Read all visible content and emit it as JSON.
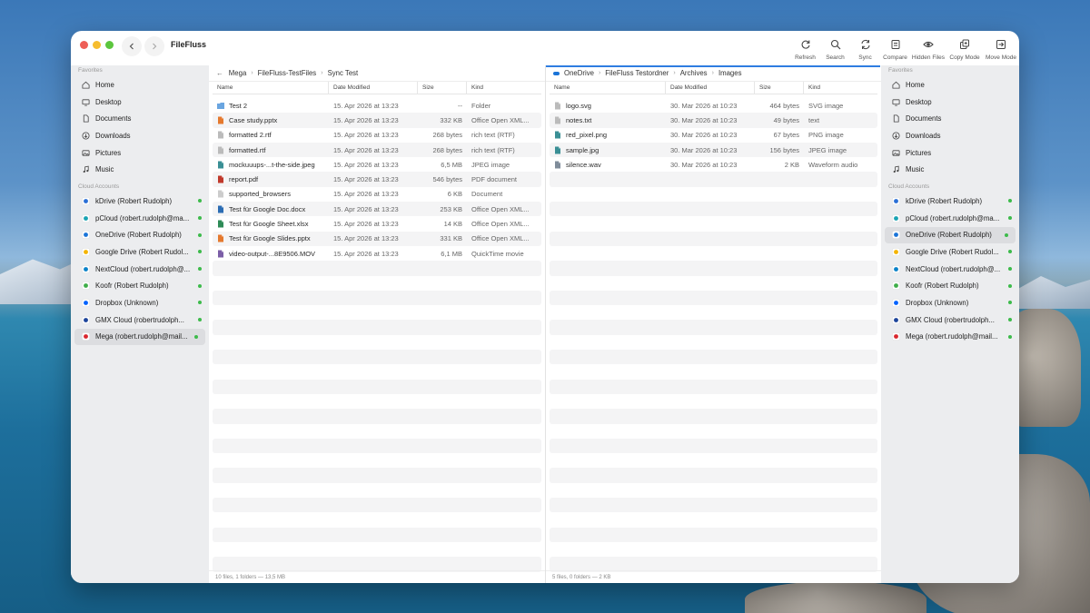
{
  "app": {
    "title": "FileFluss"
  },
  "toolbar": [
    {
      "label": "Refresh",
      "icon": "refresh-icon"
    },
    {
      "label": "Search",
      "icon": "search-icon"
    },
    {
      "label": "Sync",
      "icon": "sync-icon"
    },
    {
      "label": "Compare",
      "icon": "compare-icon"
    },
    {
      "label": "Hidden Files",
      "icon": "eye-icon"
    },
    {
      "label": "Copy Mode",
      "icon": "copy-icon"
    },
    {
      "label": "Move Mode",
      "icon": "move-icon"
    }
  ],
  "sidebar": {
    "favorites_heading": "Favorites",
    "cloud_heading": "Cloud Accounts",
    "favorites": [
      {
        "label": "Home",
        "icon": "home-icon"
      },
      {
        "label": "Desktop",
        "icon": "desktop-icon"
      },
      {
        "label": "Documents",
        "icon": "document-icon"
      },
      {
        "label": "Downloads",
        "icon": "download-icon"
      },
      {
        "label": "Pictures",
        "icon": "picture-icon"
      },
      {
        "label": "Music",
        "icon": "music-icon"
      }
    ],
    "clouds": [
      {
        "label": "kDrive (Robert Rudolph)",
        "icon": "kdrive-icon",
        "color": "#2a6fd6"
      },
      {
        "label": "pCloud (robert.rudolph@ma...",
        "icon": "pcloud-icon",
        "color": "#19a3b3"
      },
      {
        "label": "OneDrive (Robert Rudolph)",
        "icon": "onedrive-icon",
        "color": "#1a74d8"
      },
      {
        "label": "Google Drive (Robert Rudol...",
        "icon": "google-drive-icon",
        "color": "#f4b400"
      },
      {
        "label": "NextCloud (robert.rudolph@...",
        "icon": "nextcloud-icon",
        "color": "#0a82c9"
      },
      {
        "label": "Koofr (Robert Rudolph)",
        "icon": "koofr-icon",
        "color": "#3fae49"
      },
      {
        "label": "Dropbox (Unknown)",
        "icon": "dropbox-icon",
        "color": "#0061fe"
      },
      {
        "label": "GMX Cloud (robertrudolph...",
        "icon": "gmx-icon",
        "color": "#1c449b"
      },
      {
        "label": "Mega (robert.rudolph@mail...",
        "icon": "mega-icon",
        "color": "#d9272e"
      }
    ],
    "status_color": "#3dbb4b"
  },
  "left_pane": {
    "breadcrumb": [
      "Mega",
      "FileFluss-TestFiles",
      "Sync Test"
    ],
    "columns": [
      "Name",
      "Date Modified",
      "Size",
      "Kind"
    ],
    "files": [
      {
        "name": "Test 2",
        "date": "15. Apr 2026 at 13:23",
        "size": "--",
        "kind": "Folder",
        "icon": "folder-icon",
        "color": "#6aa5e0"
      },
      {
        "name": "Case study.pptx",
        "date": "15. Apr 2026 at 13:23",
        "size": "332 KB",
        "kind": "Office Open XML...",
        "icon": "pptx-icon",
        "color": "#e5792e"
      },
      {
        "name": "formatted 2.rtf",
        "date": "15. Apr 2026 at 13:23",
        "size": "268 bytes",
        "kind": "rich text (RTF)",
        "icon": "rtf-icon",
        "color": "#bbbbbb"
      },
      {
        "name": "formatted.rtf",
        "date": "15. Apr 2026 at 13:23",
        "size": "268 bytes",
        "kind": "rich text (RTF)",
        "icon": "rtf-icon",
        "color": "#bbbbbb"
      },
      {
        "name": "mockuuups-...t-the-side.jpeg",
        "date": "15. Apr 2026 at 13:23",
        "size": "6,5 MB",
        "kind": "JPEG image",
        "icon": "image-icon",
        "color": "#3a8f95"
      },
      {
        "name": "report.pdf",
        "date": "15. Apr 2026 at 13:23",
        "size": "546 bytes",
        "kind": "PDF document",
        "icon": "pdf-icon",
        "color": "#c0392b"
      },
      {
        "name": "supported_browsers",
        "date": "15. Apr 2026 at 13:23",
        "size": "6 KB",
        "kind": "Document",
        "icon": "document-icon",
        "color": "#cccccc"
      },
      {
        "name": "Test für Google Doc.docx",
        "date": "15. Apr 2026 at 13:23",
        "size": "253 KB",
        "kind": "Office Open XML...",
        "icon": "docx-icon",
        "color": "#2b6cb3"
      },
      {
        "name": "Test für Google Sheet.xlsx",
        "date": "15. Apr 2026 at 13:23",
        "size": "14 KB",
        "kind": "Office Open XML...",
        "icon": "xlsx-icon",
        "color": "#2e8b57"
      },
      {
        "name": "Test für Google Slides.pptx",
        "date": "15. Apr 2026 at 13:23",
        "size": "331 KB",
        "kind": "Office Open XML...",
        "icon": "pptx-icon",
        "color": "#e5792e"
      },
      {
        "name": "video-output-...8E9506.MOV",
        "date": "15. Apr 2026 at 13:23",
        "size": "6,1 MB",
        "kind": "QuickTime movie",
        "icon": "video-icon",
        "color": "#7b5ea7"
      }
    ],
    "status": "10 files, 1 folders — 13,5 MB"
  },
  "right_pane": {
    "breadcrumb": [
      "OneDrive",
      "FileFluss Testordner",
      "Archives",
      "Images"
    ],
    "columns": [
      "Name",
      "Date Modified",
      "Size",
      "Kind"
    ],
    "files": [
      {
        "name": "logo.svg",
        "date": "30. Mar 2026 at 10:23",
        "size": "464 bytes",
        "kind": "SVG image",
        "icon": "svg-file-icon",
        "color": "#bbbbbb"
      },
      {
        "name": "notes.txt",
        "date": "30. Mar 2026 at 10:23",
        "size": "49 bytes",
        "kind": "text",
        "icon": "text-file-icon",
        "color": "#bbbbbb"
      },
      {
        "name": "red_pixel.png",
        "date": "30. Mar 2026 at 10:23",
        "size": "67 bytes",
        "kind": "PNG image",
        "icon": "image-icon",
        "color": "#3a8f95"
      },
      {
        "name": "sample.jpg",
        "date": "30. Mar 2026 at 10:23",
        "size": "156 bytes",
        "kind": "JPEG image",
        "icon": "image-icon",
        "color": "#3a8f95"
      },
      {
        "name": "silence.wav",
        "date": "30. Mar 2026 at 10:23",
        "size": "2 KB",
        "kind": "Waveform audio",
        "icon": "audio-icon",
        "color": "#7f8c9a"
      }
    ],
    "status": "5 files, 0 folders — 2 KB"
  }
}
